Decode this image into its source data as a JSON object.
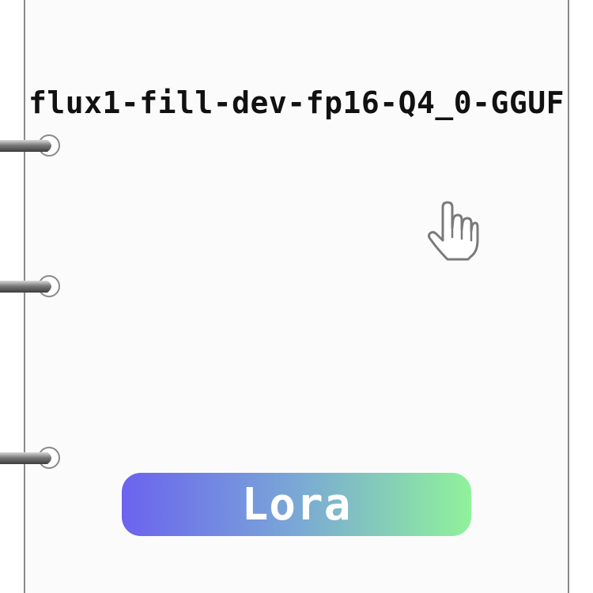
{
  "card": {
    "title": "flux1-fill-dev-fp16-Q4_0-GGUF"
  },
  "cursor": {
    "icon": "hand-pointer-icon"
  },
  "action_button": {
    "label": "Lora",
    "gradient_start": "#6b63ef",
    "gradient_end": "#8ff29a",
    "text_color": "#ffffff"
  },
  "binder": {
    "ring_count": 3,
    "ring_icon": "binder-ring-icon"
  }
}
